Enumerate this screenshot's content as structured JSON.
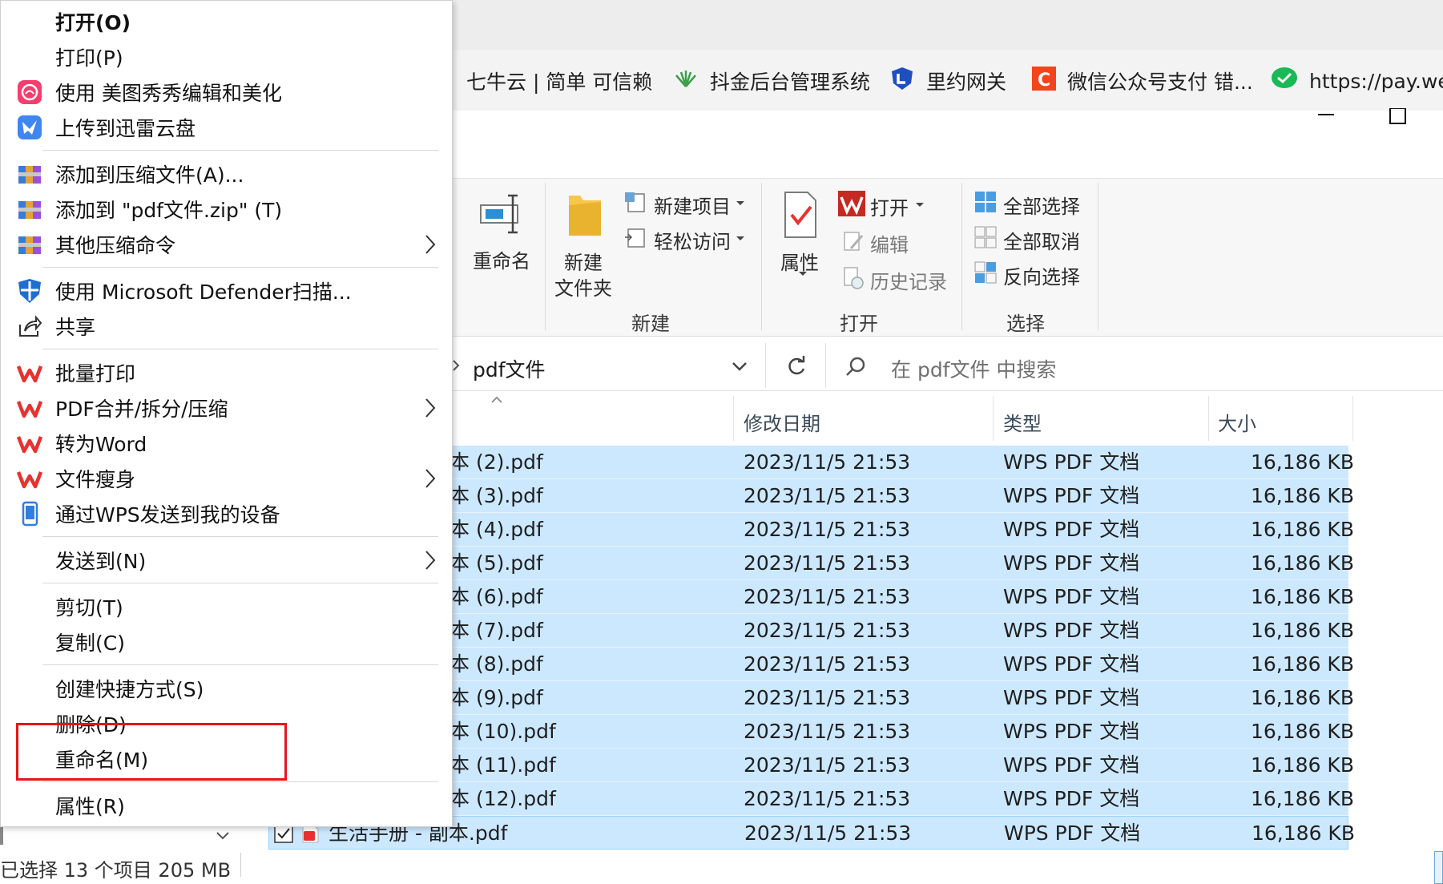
{
  "bookmarks": [
    {
      "label": "七牛云 | 简单 可信赖",
      "icon": "qiniu-icon"
    },
    {
      "label": "抖金后台管理系统",
      "icon": "leaf-icon"
    },
    {
      "label": "里约网关",
      "icon": "shield-logo-icon"
    },
    {
      "label": "微信公众号支付 错...",
      "icon": "csdn-icon"
    },
    {
      "label": "https://pay.we",
      "icon": "wechat-icon"
    }
  ],
  "ribbon": {
    "rename": "重命名",
    "new_folder_l1": "新建",
    "new_folder_l2": "文件夹",
    "new_item": "新建项目",
    "easy_access": "轻松访问",
    "group_new": "新建",
    "properties": "属性",
    "open": "打开",
    "edit": "编辑",
    "history": "历史记录",
    "group_open": "打开",
    "select_all": "全部选择",
    "select_none": "全部取消",
    "invert": "反向选择",
    "group_select": "选择"
  },
  "address": {
    "path": "pdf文件",
    "search_placeholder": "在 pdf文件 中搜索"
  },
  "columns": {
    "date": "修改日期",
    "type": "类型",
    "size": "大小"
  },
  "files": [
    {
      "name": "本 (2).pdf",
      "date": "2023/11/5 21:53",
      "type": "WPS PDF 文档",
      "size": "16,186 KB"
    },
    {
      "name": "本 (3).pdf",
      "date": "2023/11/5 21:53",
      "type": "WPS PDF 文档",
      "size": "16,186 KB"
    },
    {
      "name": "本 (4).pdf",
      "date": "2023/11/5 21:53",
      "type": "WPS PDF 文档",
      "size": "16,186 KB"
    },
    {
      "name": "本 (5).pdf",
      "date": "2023/11/5 21:53",
      "type": "WPS PDF 文档",
      "size": "16,186 KB"
    },
    {
      "name": "本 (6).pdf",
      "date": "2023/11/5 21:53",
      "type": "WPS PDF 文档",
      "size": "16,186 KB"
    },
    {
      "name": "本 (7).pdf",
      "date": "2023/11/5 21:53",
      "type": "WPS PDF 文档",
      "size": "16,186 KB"
    },
    {
      "name": "本 (8).pdf",
      "date": "2023/11/5 21:53",
      "type": "WPS PDF 文档",
      "size": "16,186 KB"
    },
    {
      "name": "本 (9).pdf",
      "date": "2023/11/5 21:53",
      "type": "WPS PDF 文档",
      "size": "16,186 KB"
    },
    {
      "name": "本 (10).pdf",
      "date": "2023/11/5 21:53",
      "type": "WPS PDF 文档",
      "size": "16,186 KB"
    },
    {
      "name": "本 (11).pdf",
      "date": "2023/11/5 21:53",
      "type": "WPS PDF 文档",
      "size": "16,186 KB"
    },
    {
      "name": "本 (12).pdf",
      "date": "2023/11/5 21:53",
      "type": "WPS PDF 文档",
      "size": "16,186 KB"
    },
    {
      "name": "生活手册 - 副本.pdf",
      "date": "2023/11/5 21:53",
      "type": "WPS PDF 文档",
      "size": "16,186 KB"
    }
  ],
  "status": "已选择 13 个项目  205 MB",
  "menu": {
    "open": "打开(O)",
    "print": "打印(P)",
    "meitu": "使用 美图秀秀编辑和美化",
    "xunlei": "上传到迅雷云盘",
    "add_archive": "添加到压缩文件(A)...",
    "add_zip": "添加到 \"pdf文件.zip\" (T)",
    "other_compress": "其他压缩命令",
    "defender": "使用 Microsoft Defender扫描...",
    "share": "共享",
    "batch_print": "批量打印",
    "pdf_merge": "PDF合并/拆分/压缩",
    "to_word": "转为Word",
    "slim": "文件瘦身",
    "wps_send": "通过WPS发送到我的设备",
    "send_to": "发送到(N)",
    "cut": "剪切(T)",
    "copy": "复制(C)",
    "shortcut": "创建快捷方式(S)",
    "delete": "删除(D)",
    "rename": "重命名(M)",
    "properties": "属性(R)"
  },
  "colors": {
    "selection": "#cce8ff",
    "highlight_box": "#e8141b",
    "wps_red": "#e8322f"
  }
}
